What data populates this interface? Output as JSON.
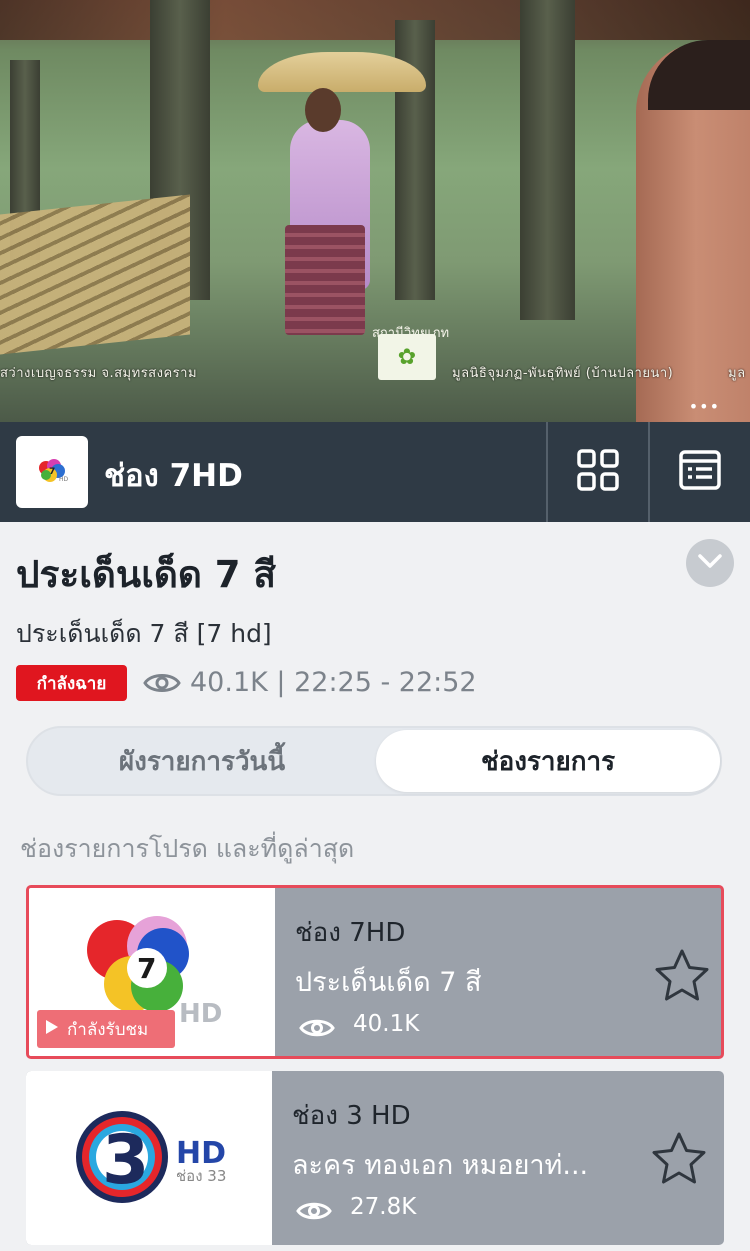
{
  "video": {
    "captions": {
      "left": "สว่างเบญจธรรม จ.สมุทรสงคราม",
      "center_top": "สถานีวิทยุเภท",
      "right": "มูลนิธิจุมภฏ-พันธุทิพย์ (บ้านปลายนา)",
      "far_right": "มูล"
    },
    "more_icon": "more-dots-icon"
  },
  "channel_bar": {
    "channel_name": "ช่อง 7HD",
    "logo_icon": "channel7-logo",
    "grid_icon": "grid-icon",
    "list_icon": "program-list-icon"
  },
  "program": {
    "title": "ประเด็นเด็ด 7 สี",
    "subtitle": "ประเด็นเด็ด 7 สี [7 hd]",
    "live_badge": "กำลังฉาย",
    "meta": "40.1K | 22:25 - 22:52"
  },
  "tabs": {
    "left": "ผังรายการวันนี้",
    "right": "ช่องรายการ",
    "selected": "right"
  },
  "section": {
    "title": "ช่องรายการโปรด และที่ดูล่าสุด"
  },
  "cards": [
    {
      "channel": "ช่อง 7HD",
      "program": "ประเด็นเด็ด 7 สี",
      "views": "40.1K",
      "badge": "กำลังรับชม",
      "logo_text": "7",
      "logo_hd": "HD",
      "active": true
    },
    {
      "channel": "ช่อง 3 HD",
      "program": "ละคร ทองเอก หมอยาท่...",
      "views": "27.8K",
      "logo_text": "3",
      "logo_hd": "HD",
      "logo_sub": "ช่อง 33",
      "active": false
    }
  ],
  "colors": {
    "bar_bg": "#2f3a45",
    "live_red": "#e0161f",
    "active_border": "#e74b5a",
    "card_bg": "#9ba1aa"
  }
}
